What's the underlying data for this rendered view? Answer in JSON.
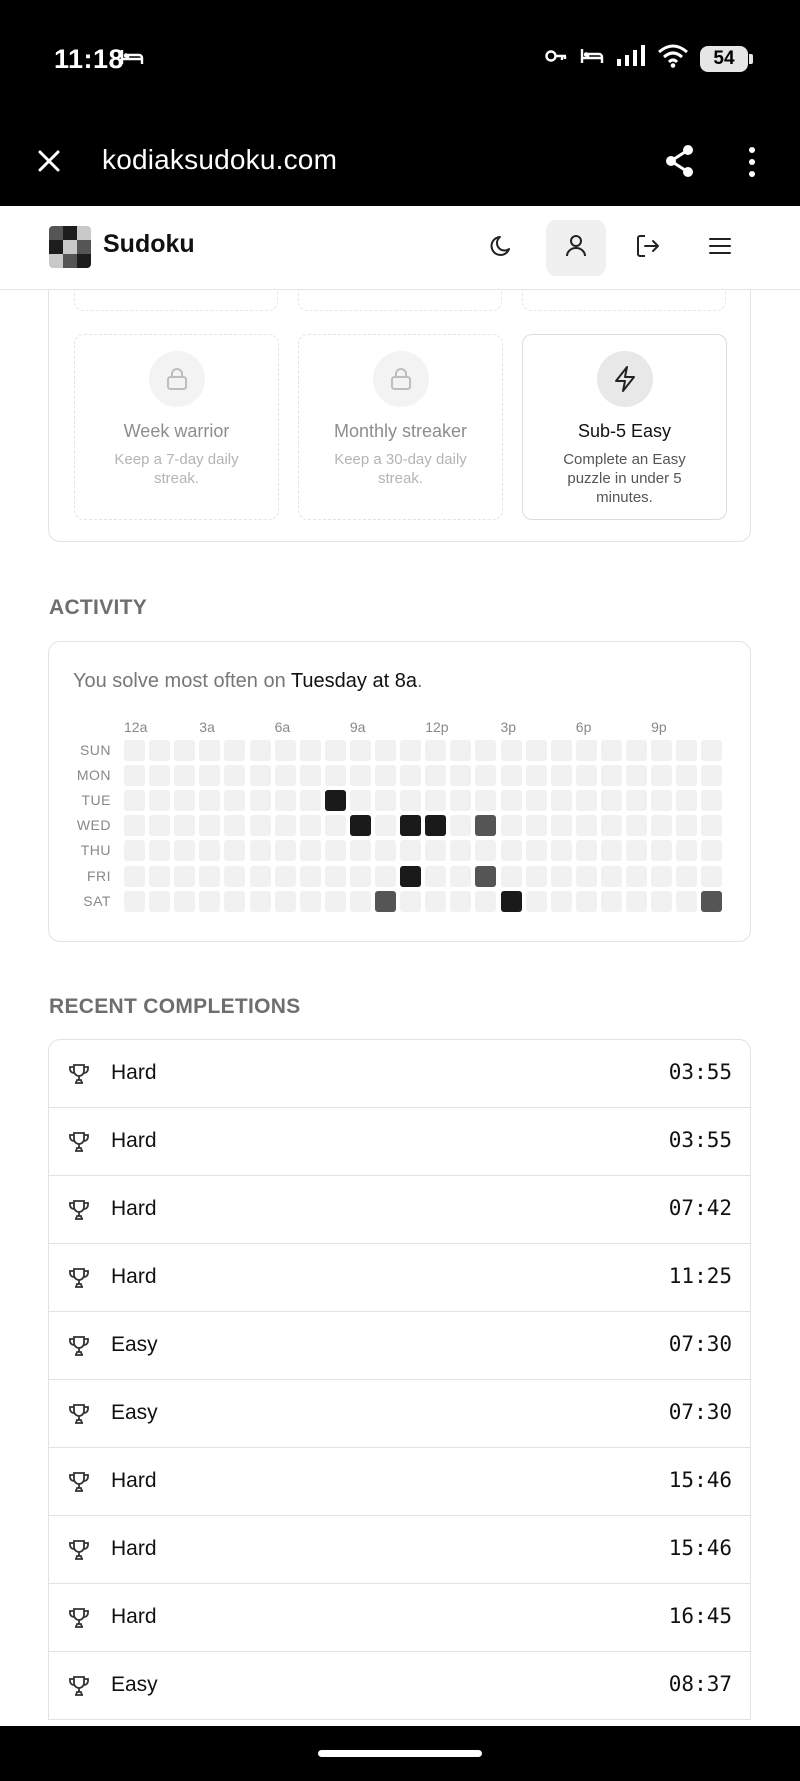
{
  "status_bar": {
    "time": "11:18",
    "left_icons": [
      "bed-icon"
    ],
    "right_icons": [
      "key-icon",
      "bed-icon",
      "signal-icon",
      "wifi-icon"
    ],
    "battery": "54"
  },
  "browser": {
    "url": "kodiaksudoku.com",
    "icons": [
      "close-icon",
      "share-icon",
      "more-vertical-icon"
    ]
  },
  "header": {
    "title": "Sudoku",
    "icons": [
      "moon-icon",
      "user-icon",
      "logout-icon",
      "menu-icon"
    ],
    "active_icon": "user-icon"
  },
  "achievements": [
    {
      "title": "Week warrior",
      "description": "Keep a 7-day daily streak.",
      "unlocked": false,
      "icon": "lock-icon"
    },
    {
      "title": "Monthly streaker",
      "description": "Keep a 30-day daily streak.",
      "unlocked": false,
      "icon": "lock-icon"
    },
    {
      "title": "Sub-5 Easy",
      "description": "Complete an Easy puzzle in under 5 minutes.",
      "unlocked": true,
      "icon": "lightning-icon"
    }
  ],
  "activity": {
    "heading": "ACTIVITY",
    "summary_prefix": "You solve most often on ",
    "summary_highlight": "Tuesday at 8a",
    "summary_suffix": ".",
    "hour_labels": [
      "12a",
      "3a",
      "6a",
      "9a",
      "12p",
      "3p",
      "6p",
      "9p"
    ],
    "days": [
      "SUN",
      "MON",
      "TUE",
      "WED",
      "THU",
      "FRI",
      "SAT"
    ],
    "active_cells": [
      {
        "day": "TUE",
        "hour": 8,
        "intensity": "high"
      },
      {
        "day": "WED",
        "hour": 9,
        "intensity": "high"
      },
      {
        "day": "WED",
        "hour": 11,
        "intensity": "high"
      },
      {
        "day": "WED",
        "hour": 12,
        "intensity": "high"
      },
      {
        "day": "WED",
        "hour": 14,
        "intensity": "medium"
      },
      {
        "day": "FRI",
        "hour": 11,
        "intensity": "high"
      },
      {
        "day": "FRI",
        "hour": 14,
        "intensity": "medium"
      },
      {
        "day": "SAT",
        "hour": 10,
        "intensity": "medium"
      },
      {
        "day": "SAT",
        "hour": 15,
        "intensity": "high"
      },
      {
        "day": "SAT",
        "hour": 23,
        "intensity": "medium"
      }
    ],
    "colors": {
      "empty": "#f1f1f1",
      "medium": "#555555",
      "high": "#1a1a1a"
    }
  },
  "recent": {
    "heading": "RECENT COMPLETIONS",
    "items": [
      {
        "difficulty": "Hard",
        "time": "03:55"
      },
      {
        "difficulty": "Hard",
        "time": "03:55"
      },
      {
        "difficulty": "Hard",
        "time": "07:42"
      },
      {
        "difficulty": "Hard",
        "time": "11:25"
      },
      {
        "difficulty": "Easy",
        "time": "07:30"
      },
      {
        "difficulty": "Easy",
        "time": "07:30"
      },
      {
        "difficulty": "Hard",
        "time": "15:46"
      },
      {
        "difficulty": "Hard",
        "time": "15:46"
      },
      {
        "difficulty": "Hard",
        "time": "16:45"
      },
      {
        "difficulty": "Easy",
        "time": "08:37"
      }
    ]
  }
}
